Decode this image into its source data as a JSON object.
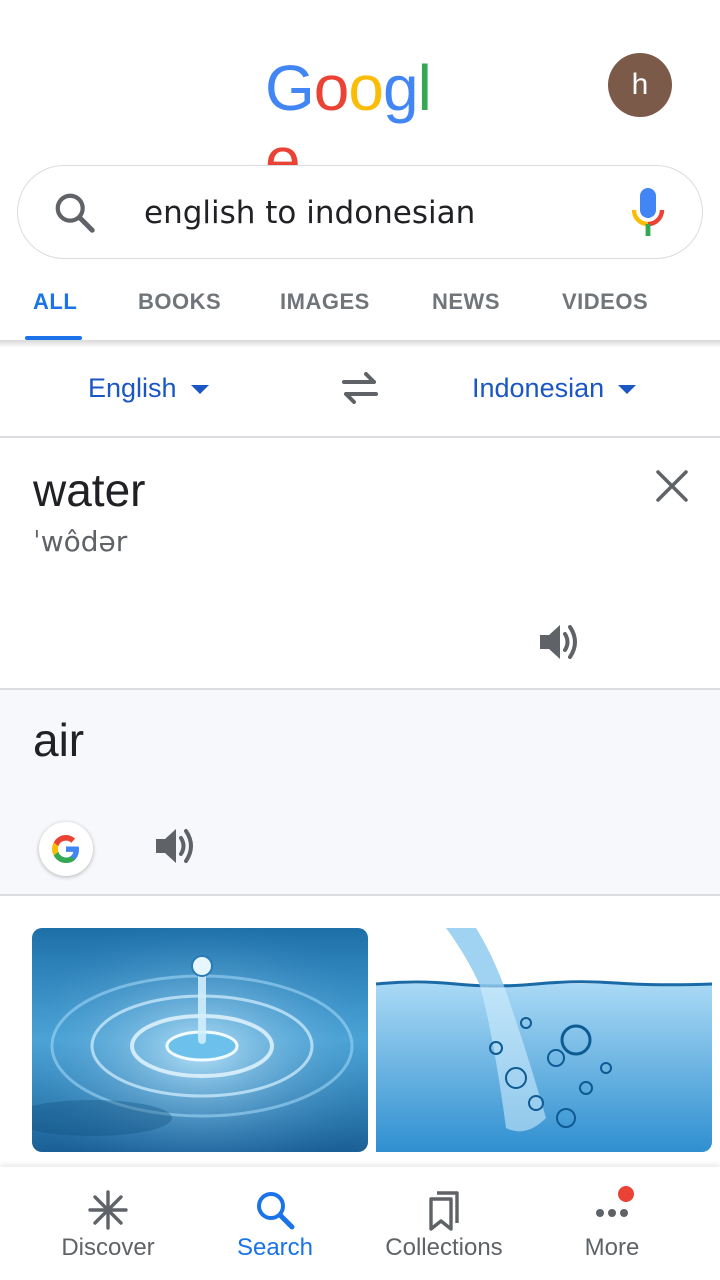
{
  "header": {
    "logo_letters": [
      {
        "char": "G",
        "color": "#4285F4"
      },
      {
        "char": "o",
        "color": "#EA4335"
      },
      {
        "char": "o",
        "color": "#FBBC05"
      },
      {
        "char": "g",
        "color": "#4285F4"
      },
      {
        "char": "l",
        "color": "#34A853"
      },
      {
        "char": "e",
        "color": "#EA4335"
      }
    ],
    "avatar_initial": "h",
    "avatar_color": "#7b5a4a"
  },
  "search": {
    "query": "english to indonesian",
    "search_icon": "search-icon",
    "mic_icon": "mic-icon"
  },
  "tabs": [
    {
      "label": "ALL",
      "active": true
    },
    {
      "label": "BOOKS",
      "active": false
    },
    {
      "label": "IMAGES",
      "active": false
    },
    {
      "label": "NEWS",
      "active": false
    },
    {
      "label": "VIDEOS",
      "active": false
    }
  ],
  "translator": {
    "source_language": "English",
    "target_language": "Indonesian",
    "swap_icon": "swap-icon",
    "source_text": "water",
    "source_phonetic": "ˈwôdər",
    "target_text": "air",
    "accent_color": "#1a56c4"
  },
  "images": [
    {
      "description": "water-drop-ripple-image"
    },
    {
      "description": "water-pour-bubbles-image"
    }
  ],
  "bottom_nav": [
    {
      "label": "Discover",
      "icon": "asterisk-icon",
      "active": false
    },
    {
      "label": "Search",
      "icon": "search-icon",
      "active": true
    },
    {
      "label": "Collections",
      "icon": "bookmark-icon",
      "active": false
    },
    {
      "label": "More",
      "icon": "more-dots-icon",
      "active": false,
      "notification": true
    }
  ]
}
